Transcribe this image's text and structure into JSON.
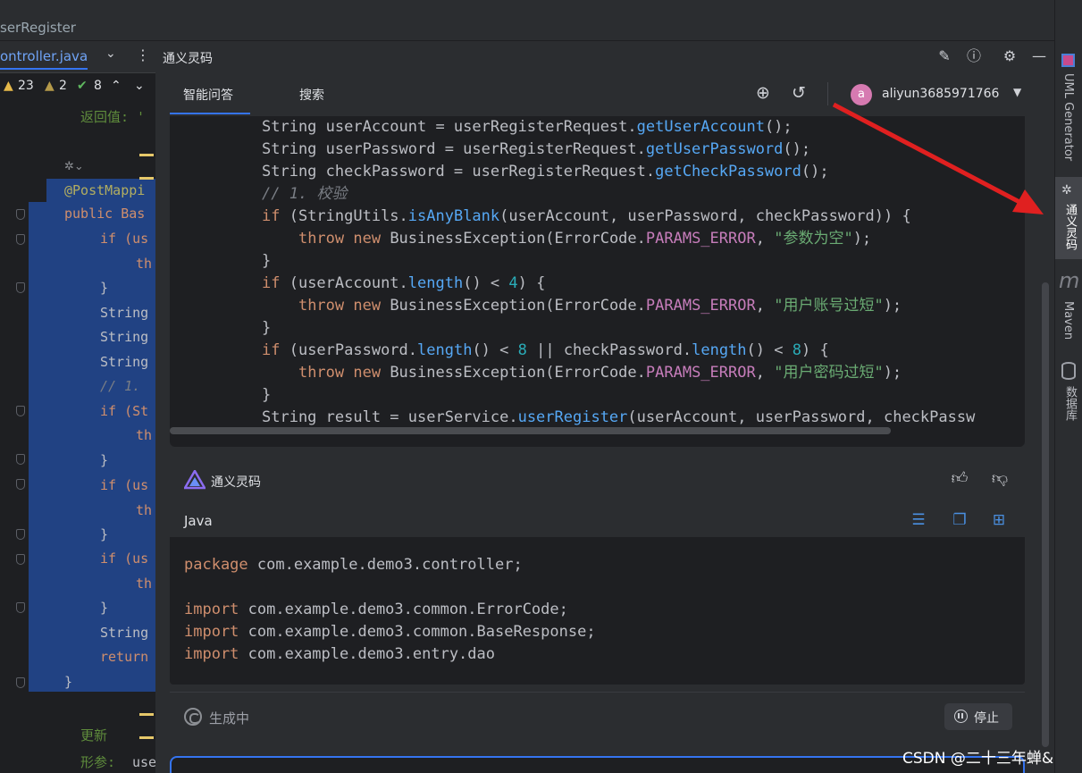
{
  "breadcrumb": {
    "label": "serRegister"
  },
  "editor": {
    "file_tab": "ontroller.java",
    "inspections": {
      "warnings": "23",
      "weak_warnings": "2",
      "ok": "8"
    },
    "doc_return": "返回值: '",
    "doc_update": "更新",
    "doc_param": "形参:",
    "doc_param_value": "use",
    "annotation": "@PostMappi",
    "lines": [
      {
        "kind": "kw",
        "text": "public Bas"
      },
      {
        "kind": "kw",
        "text": "if (us"
      },
      {
        "kind": "kw",
        "text": "th"
      },
      {
        "kind": "plain",
        "text": "}"
      },
      {
        "kind": "plain",
        "text": "String"
      },
      {
        "kind": "plain",
        "text": "String"
      },
      {
        "kind": "plain",
        "text": "String"
      },
      {
        "kind": "cmt",
        "text": "// 1. "
      },
      {
        "kind": "kw",
        "text": "if (St"
      },
      {
        "kind": "kw",
        "text": "th"
      },
      {
        "kind": "plain",
        "text": "}"
      },
      {
        "kind": "kw",
        "text": "if (us"
      },
      {
        "kind": "kw",
        "text": "th"
      },
      {
        "kind": "plain",
        "text": "}"
      },
      {
        "kind": "kw",
        "text": "if (us"
      },
      {
        "kind": "kw",
        "text": "th"
      },
      {
        "kind": "plain",
        "text": "}"
      },
      {
        "kind": "plain",
        "text": "String"
      },
      {
        "kind": "kw",
        "text": "return"
      },
      {
        "kind": "plain",
        "text": "}"
      }
    ]
  },
  "tool_window": {
    "title": "通义灵码",
    "tabs": [
      {
        "label": "智能问答",
        "active": true
      },
      {
        "label": "搜索",
        "active": false
      }
    ],
    "user": {
      "avatar_letter": "a",
      "name": "aliyun3685971766"
    }
  },
  "code_block_1": {
    "lines": [
      [
        [
          "plain",
          "String userAccount = userRegisterRequest."
        ],
        [
          "fn",
          "getUserAccount"
        ],
        [
          "plain",
          "();"
        ]
      ],
      [
        [
          "plain",
          "String userPassword = userRegisterRequest."
        ],
        [
          "fn",
          "getUserPassword"
        ],
        [
          "plain",
          "();"
        ]
      ],
      [
        [
          "plain",
          "String checkPassword = userRegisterRequest."
        ],
        [
          "fn",
          "getCheckPassword"
        ],
        [
          "plain",
          "();"
        ]
      ],
      [
        [
          "cmt",
          "// 1. 校验"
        ]
      ],
      [
        [
          "kw",
          "if "
        ],
        [
          "plain",
          "(StringUtils."
        ],
        [
          "fn",
          "isAnyBlank"
        ],
        [
          "plain",
          "(userAccount, userPassword, checkPassword)) {"
        ]
      ],
      [
        [
          "plain",
          "    "
        ],
        [
          "kw",
          "throw new "
        ],
        [
          "plain",
          "BusinessException(ErrorCode."
        ],
        [
          "field",
          "PARAMS_ERROR"
        ],
        [
          "plain",
          ", "
        ],
        [
          "str",
          "\"参数为空\""
        ],
        [
          "plain",
          ");"
        ]
      ],
      [
        [
          "plain",
          "}"
        ]
      ],
      [
        [
          "kw",
          "if "
        ],
        [
          "plain",
          "(userAccount."
        ],
        [
          "fn",
          "length"
        ],
        [
          "plain",
          "() < "
        ],
        [
          "num",
          "4"
        ],
        [
          "plain",
          ") {"
        ]
      ],
      [
        [
          "plain",
          "    "
        ],
        [
          "kw",
          "throw new "
        ],
        [
          "plain",
          "BusinessException(ErrorCode."
        ],
        [
          "field",
          "PARAMS_ERROR"
        ],
        [
          "plain",
          ", "
        ],
        [
          "str",
          "\"用户账号过短\""
        ],
        [
          "plain",
          ");"
        ]
      ],
      [
        [
          "plain",
          "}"
        ]
      ],
      [
        [
          "kw",
          "if "
        ],
        [
          "plain",
          "(userPassword."
        ],
        [
          "fn",
          "length"
        ],
        [
          "plain",
          "() < "
        ],
        [
          "num",
          "8"
        ],
        [
          "plain",
          " || checkPassword."
        ],
        [
          "fn",
          "length"
        ],
        [
          "plain",
          "() < "
        ],
        [
          "num",
          "8"
        ],
        [
          "plain",
          ") {"
        ]
      ],
      [
        [
          "plain",
          "    "
        ],
        [
          "kw",
          "throw new "
        ],
        [
          "plain",
          "BusinessException(ErrorCode."
        ],
        [
          "field",
          "PARAMS_ERROR"
        ],
        [
          "plain",
          ", "
        ],
        [
          "str",
          "\"用户密码过短\""
        ],
        [
          "plain",
          ");"
        ]
      ],
      [
        [
          "plain",
          "}"
        ]
      ],
      [
        [
          "plain",
          "String result = userService."
        ],
        [
          "fn",
          "userRegister"
        ],
        [
          "plain",
          "(userAccount, userPassword, checkPassw"
        ]
      ]
    ]
  },
  "response": {
    "title": "通义灵码",
    "language": "Java",
    "lines": [
      [
        [
          "kw",
          "package "
        ],
        [
          "plain",
          "com.example.demo3.controller;"
        ]
      ],
      [
        [
          "plain",
          ""
        ]
      ],
      [
        [
          "kw",
          "import "
        ],
        [
          "plain",
          "com.example.demo3.common.ErrorCode;"
        ]
      ],
      [
        [
          "kw",
          "import "
        ],
        [
          "plain",
          "com.example.demo3.common.BaseResponse;"
        ]
      ],
      [
        [
          "kw",
          "import "
        ],
        [
          "plain",
          "com.example.demo3.entry.dao"
        ]
      ]
    ],
    "status": "生成中",
    "stop_label": "停止"
  },
  "right_strip": {
    "uml": "UML Generator",
    "tongyi": "通义灵码",
    "maven": "Maven",
    "database": "数据库"
  },
  "watermark": "CSDN @二十三年蝉&",
  "colors": {
    "accent": "#3574f0",
    "selection": "#214283",
    "arrow": "#e02020"
  }
}
